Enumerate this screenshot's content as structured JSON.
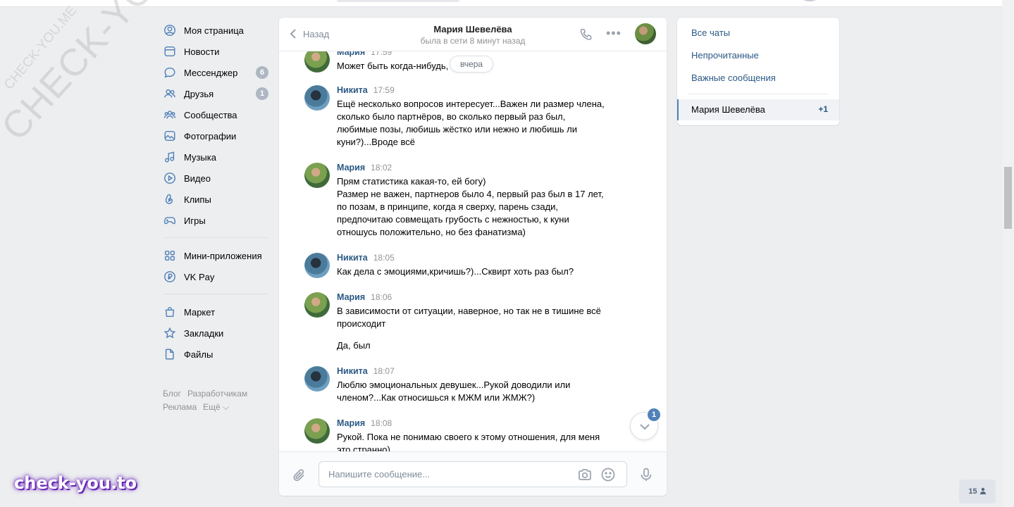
{
  "nav": {
    "items": [
      {
        "label": "Моя страница",
        "icon": "user-icon"
      },
      {
        "label": "Новости",
        "icon": "news-icon"
      },
      {
        "label": "Мессенджер",
        "icon": "message-icon",
        "count": "6"
      },
      {
        "label": "Друзья",
        "icon": "friends-icon",
        "count": "1"
      },
      {
        "label": "Сообщества",
        "icon": "communities-icon"
      },
      {
        "label": "Фотографии",
        "icon": "photo-icon"
      },
      {
        "label": "Музыка",
        "icon": "music-icon"
      },
      {
        "label": "Видео",
        "icon": "video-icon"
      },
      {
        "label": "Клипы",
        "icon": "clips-icon"
      },
      {
        "label": "Игры",
        "icon": "gamepad-icon"
      }
    ],
    "items2": [
      {
        "label": "Мини-приложения",
        "icon": "apps-icon"
      },
      {
        "label": "VK Pay",
        "icon": "vkpay-icon"
      }
    ],
    "items3": [
      {
        "label": "Маркет",
        "icon": "market-icon"
      },
      {
        "label": "Закладки",
        "icon": "bookmark-icon"
      },
      {
        "label": "Файлы",
        "icon": "file-icon"
      }
    ],
    "footer": {
      "blog": "Блог",
      "dev": "Разработчикам",
      "ads": "Реклама",
      "more": "Ещё ⌵"
    }
  },
  "chat": {
    "back": "Назад",
    "peer_name": "Мария Шевелёва",
    "peer_status": "была в сети 8 минут назад",
    "date_pill": "вчера",
    "messages": [
      {
        "author": "Мария",
        "time": "17:59",
        "text": "Может быть когда-нибудь, ...точно)"
      },
      {
        "author": "Никита",
        "time": "17:59",
        "text": "Ещё несколько вопросов интересует...Важен ли размер члена,\nсколько было партнёров, во сколько первый раз был,\nлюбимые позы, любишь жёстко или нежно и любишь ли\nкуни?)...Вроде всё"
      },
      {
        "author": "Мария",
        "time": "18:02",
        "text": "Прям статистика какая-то, ей богу)\nРазмер не важен, партнеров было 4, первый раз был в 17 лет,\nпо позам, в принципе, когда я сверху, парень сзади,\nпредпочитаю совмещать грубость с нежностью, к куни\nотношусь положительно, но без фанатизма)"
      },
      {
        "author": "Никита",
        "time": "18:05",
        "text": "Как дела с эмоциями,кричишь?)...Сквирт хоть раз был?"
      },
      {
        "author": "Мария",
        "time": "18:06",
        "text": "В зависимости от ситуации, наверное, но так не в тишине всё\nпроисходит",
        "text2": "Да, был"
      },
      {
        "author": "Никита",
        "time": "18:07",
        "text": "Люблю эмоциональных девушек...Рукой доводили или\nчленом?...Как относишься к МЖМ или ЖМЖ?)"
      },
      {
        "author": "Мария",
        "time": "18:08",
        "text": "Рукой. Пока не понимаю своего к этому отношения, для меня\nэто странно)"
      }
    ],
    "unread_badge": "1",
    "composer_placeholder": "Напишите сообщение..."
  },
  "right": {
    "all_chats": "Все чаты",
    "unread": "Непрочитанные",
    "important": "Важные сообщения",
    "active_chat": "Мария Шевелёва",
    "active_count": "+1"
  },
  "online_count": "15",
  "watermarks": {
    "big": "CHECK-YOU.ME",
    "small": "CHECK-YOU.ME",
    "brand": "check-you.to"
  },
  "colors": {
    "accent": "#5181b8",
    "link": "#2a5885",
    "background": "#edeef0"
  }
}
